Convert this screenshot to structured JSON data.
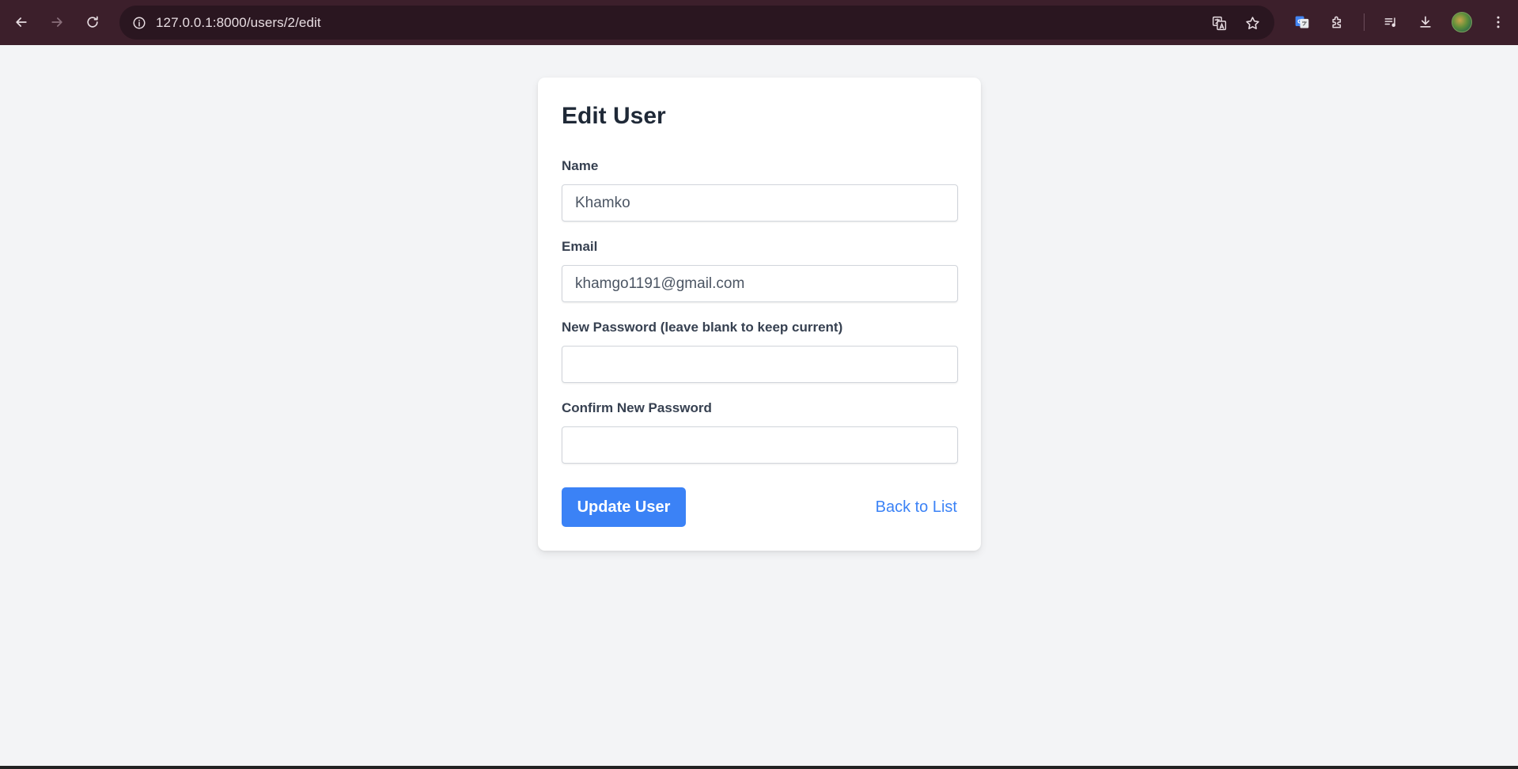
{
  "browser": {
    "url": "127.0.0.1:8000/users/2/edit"
  },
  "form": {
    "title": "Edit User",
    "name": {
      "label": "Name",
      "value": "Khamko"
    },
    "email": {
      "label": "Email",
      "value": "khamgo1191@gmail.com"
    },
    "new_password": {
      "label": "New Password (leave blank to keep current)",
      "value": ""
    },
    "confirm_password": {
      "label": "Confirm New Password",
      "value": ""
    },
    "submit_label": "Update User",
    "back_label": "Back to List"
  },
  "colors": {
    "browser_bar": "#3c1f2b",
    "page_background": "#f3f4f6",
    "accent": "#3b82f6"
  }
}
